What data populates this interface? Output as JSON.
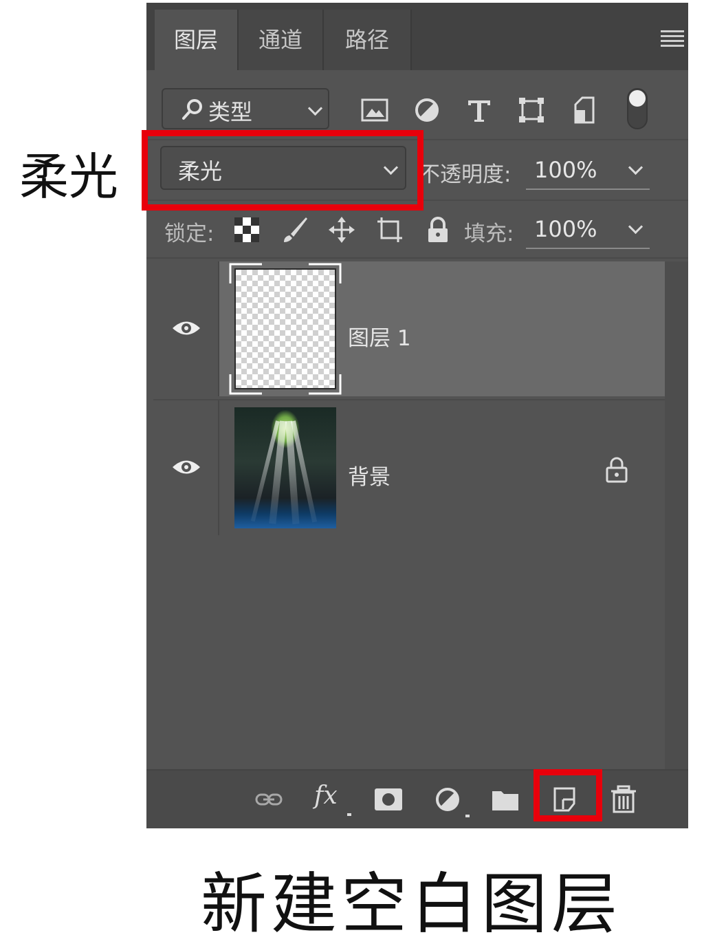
{
  "tabs": [
    {
      "label": "图层",
      "active": true
    },
    {
      "label": "通道",
      "active": false
    },
    {
      "label": "路径",
      "active": false
    }
  ],
  "filter": {
    "label": "类型"
  },
  "blend": {
    "mode": "柔光",
    "opacity_label": "不透明度:",
    "opacity_value": "100%"
  },
  "lock": {
    "label": "锁定:",
    "fill_label": "填充:",
    "fill_value": "100%"
  },
  "layers": [
    {
      "name": "图层 1",
      "selected": true,
      "visible": true,
      "locked": false
    },
    {
      "name": "背景",
      "selected": false,
      "visible": true,
      "locked": true
    }
  ],
  "annotations": {
    "left_label": "柔光",
    "bottom_caption": "新建空白图层"
  },
  "colors": {
    "panel": "#535353",
    "highlight": "#e8000b",
    "selected_row": "#6a6a6a"
  }
}
